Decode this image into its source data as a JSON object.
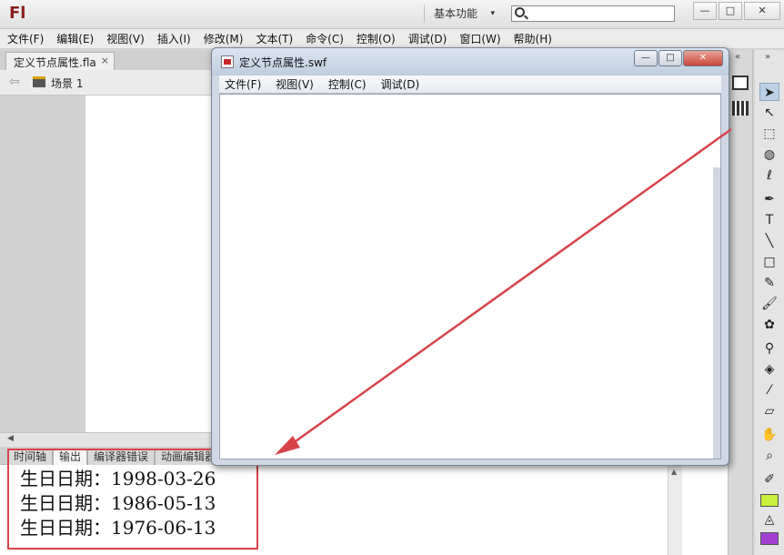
{
  "app": {
    "logo": "Fl",
    "workspace": "基本功能",
    "search_placeholder": ""
  },
  "window_controls": {
    "minimize": "—",
    "maximize": "□",
    "close": "✕"
  },
  "menu": [
    "文件(F)",
    "编辑(E)",
    "视图(V)",
    "插入(I)",
    "修改(M)",
    "文本(T)",
    "命令(C)",
    "控制(O)",
    "调试(D)",
    "窗口(W)",
    "帮助(H)"
  ],
  "document": {
    "tab_label": "定义节点属性.fla",
    "close": "×"
  },
  "scene": {
    "label": "场景 1"
  },
  "panel": {
    "tabs": [
      "时间轴",
      "输出",
      "编译器错误",
      "动画编辑器"
    ],
    "active_tab": "输出",
    "output_lines": [
      "生日日期：1998-03-26",
      "生日日期：1986-05-13",
      "生日日期：1976-06-13"
    ]
  },
  "swf_window": {
    "title": "定义节点属性.swf",
    "menu": [
      "文件(F)",
      "视图(V)",
      "控制(C)",
      "调试(D)"
    ],
    "controls": {
      "minimize": "—",
      "maximize": "□",
      "close": "✕"
    }
  },
  "colors": {
    "highlight": "#d8434a",
    "arrow": "#d8434a",
    "swatch_stroke": "#c8f03c",
    "swatch_fill": "#a23fd0"
  },
  "tools": [
    "selection-tool",
    "subselection-tool",
    "free-transform-tool",
    "3d-rotation-tool",
    "lasso-tool",
    "pen-tool",
    "text-tool",
    "line-tool",
    "rectangle-tool",
    "pencil-tool",
    "brush-tool",
    "deco-tool",
    "bone-tool",
    "paint-bucket-tool",
    "eyedropper-tool",
    "eraser-tool",
    "hand-tool",
    "zoom-tool",
    "stroke-color-tool",
    "fill-color-tool"
  ]
}
